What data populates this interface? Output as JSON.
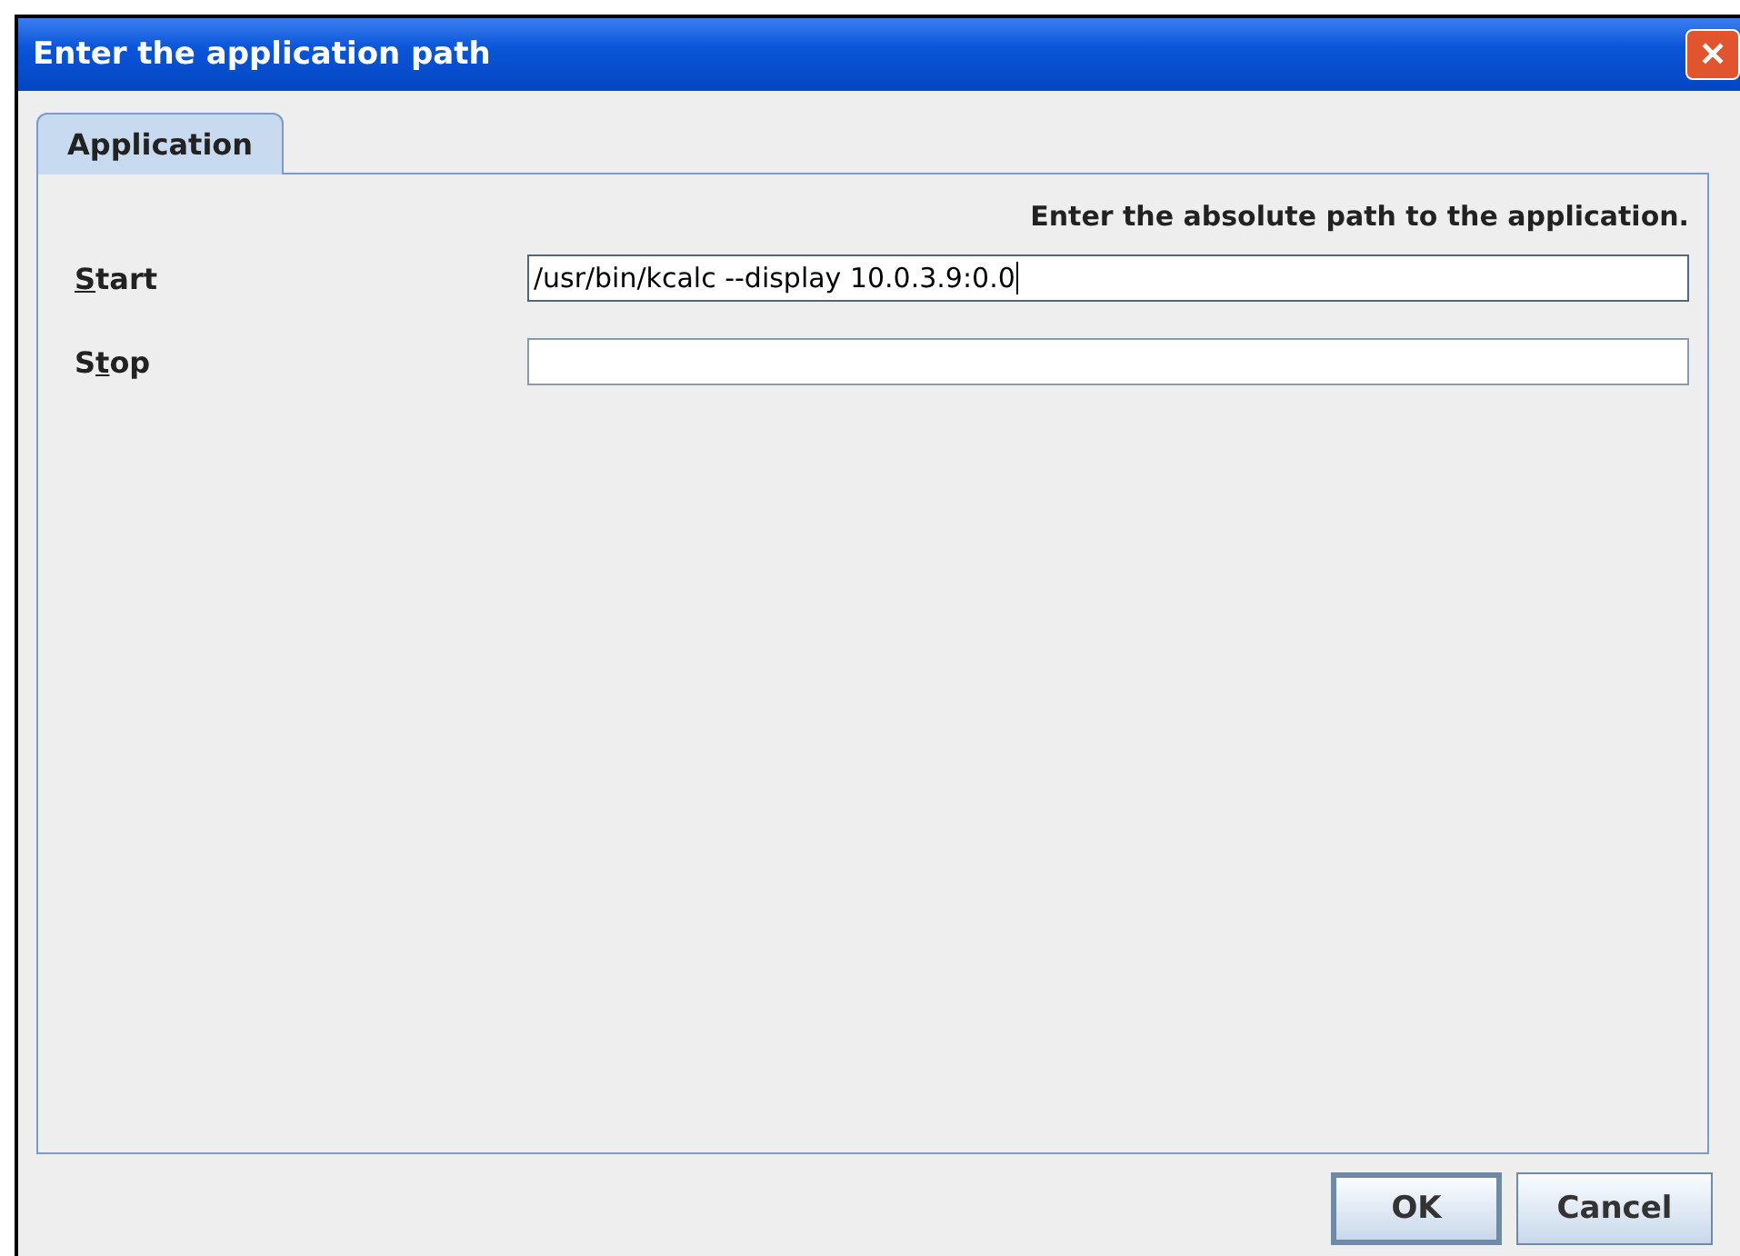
{
  "window": {
    "title": "Enter the application path",
    "close": "✕"
  },
  "tabs": [
    {
      "label": "Application",
      "selected": true
    }
  ],
  "instruction": "Enter the absolute path to the application.",
  "fields": [
    {
      "key": "S",
      "after": "tart",
      "value": "/usr/bin/kcalc --display 10.0.3.9:0.0",
      "focused": true
    },
    {
      "before": "S",
      "key": "t",
      "after": "op",
      "focused": false
    }
  ],
  "buttons": [
    {
      "label": "OK",
      "default": true
    },
    {
      "label": "Cancel",
      "default": false
    }
  ]
}
